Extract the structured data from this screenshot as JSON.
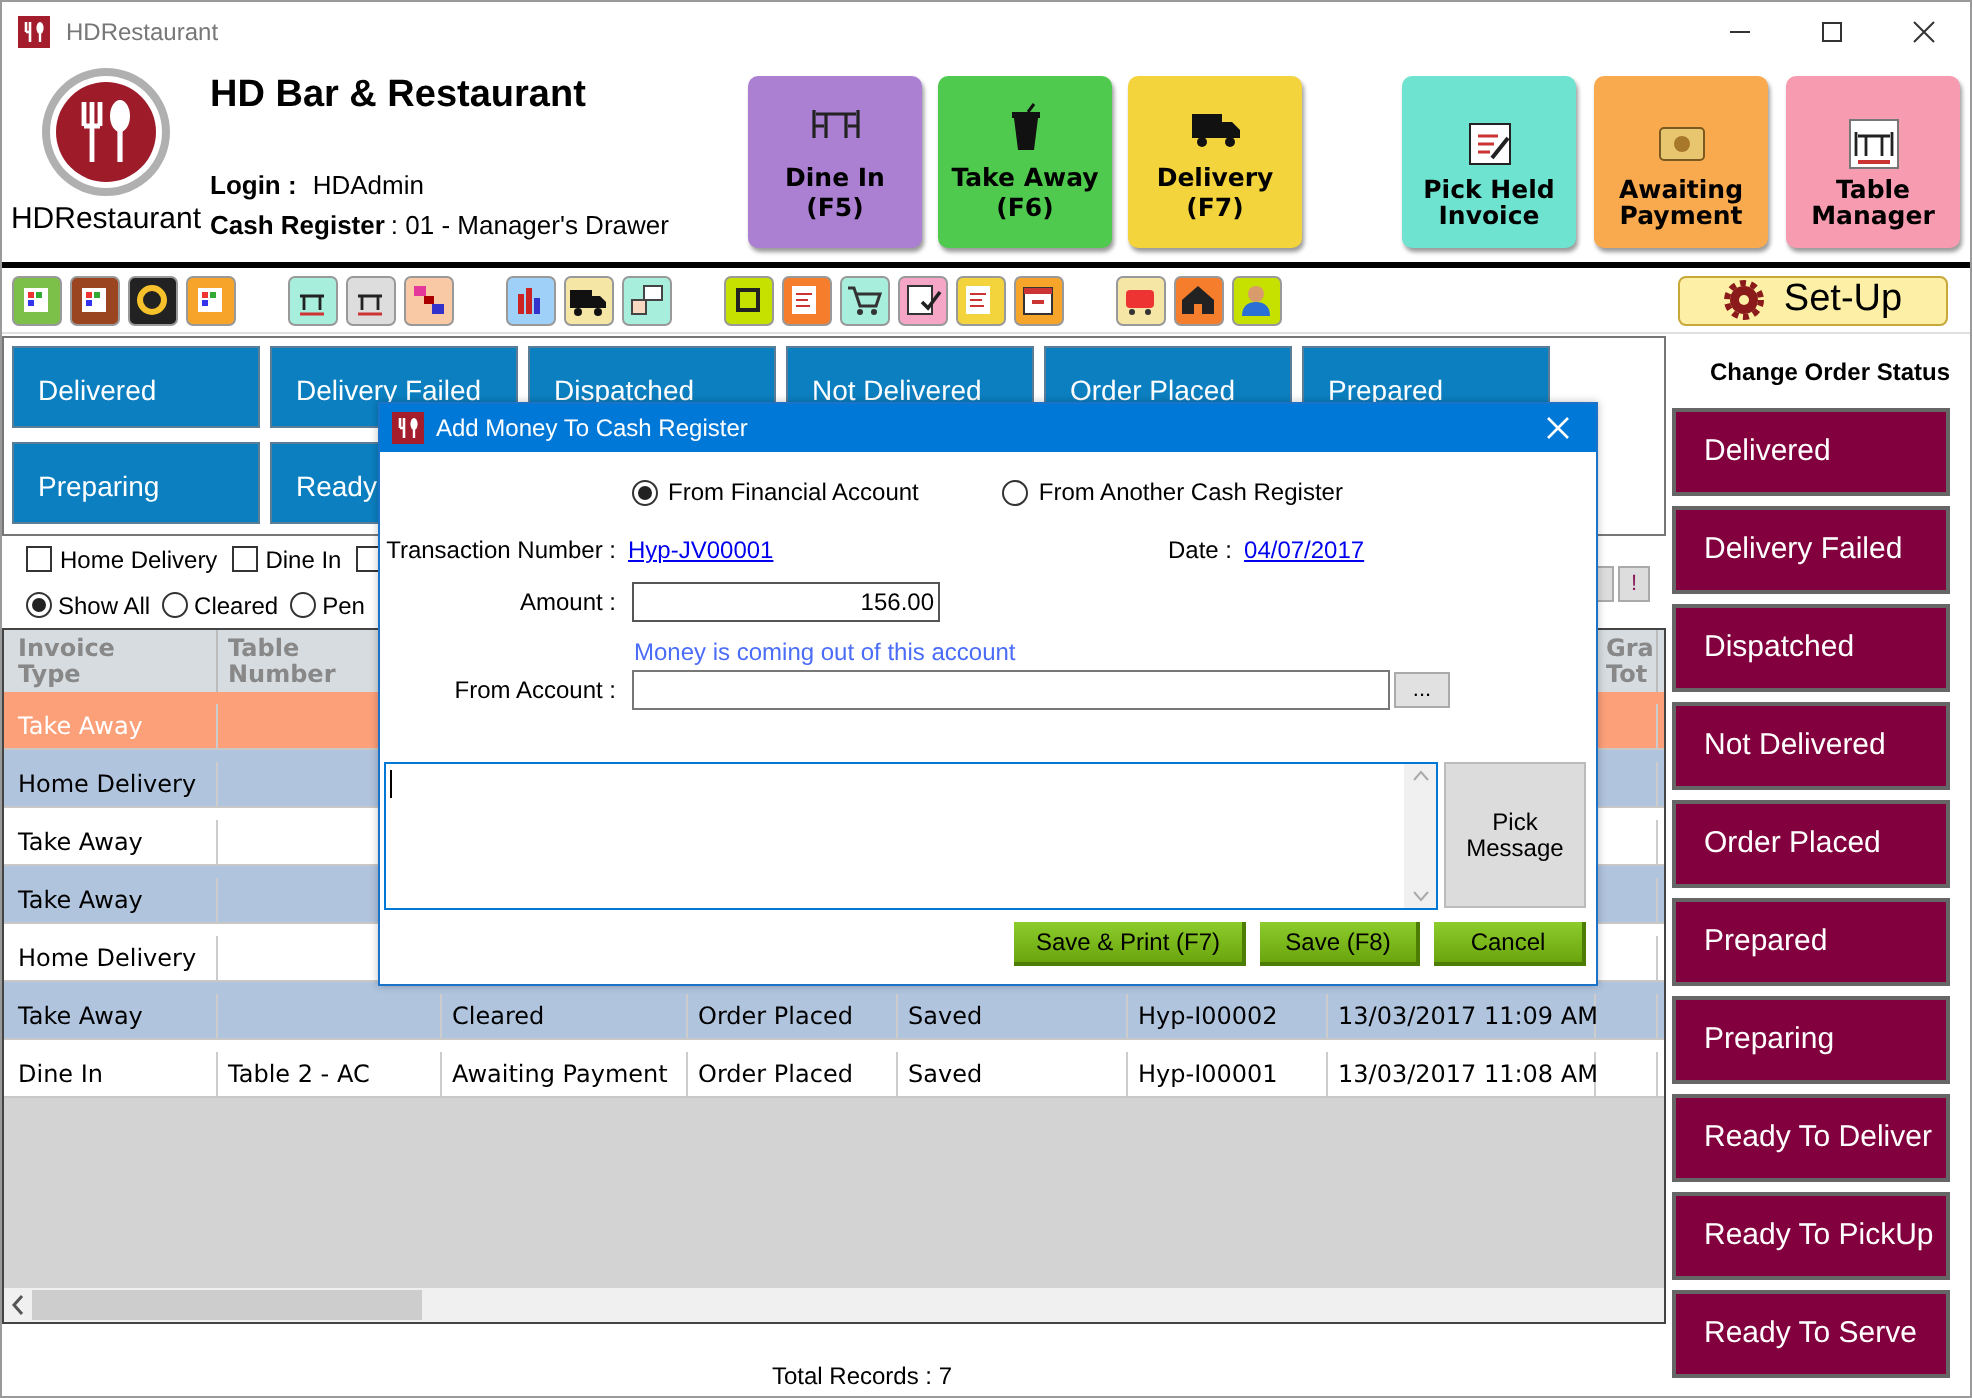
{
  "window": {
    "title": "HDRestaurant"
  },
  "header": {
    "logo_text": "HDRestaurant",
    "business_name": "HD Bar & Restaurant",
    "login_label": "Login :",
    "login_value": "HDAdmin",
    "register_label": "Cash Register",
    "register_value": ": 01 - Manager's Drawer"
  },
  "order_buttons": [
    {
      "label": "Dine In",
      "shortcut": "(F5)",
      "color": "#ab7fd1"
    },
    {
      "label": "Take Away",
      "shortcut": "(F6)",
      "color": "#4fca4f"
    },
    {
      "label": "Delivery",
      "shortcut": "(F7)",
      "color": "#f4d43c"
    }
  ],
  "quick_buttons": [
    {
      "label": "Pick Held Invoice",
      "color": "#6ee3d0"
    },
    {
      "label": "Awaiting Payment",
      "color": "#f9aa4f"
    },
    {
      "label": "Table Manager",
      "color": "#f79bb0"
    }
  ],
  "setup_button": {
    "label": "Set-Up"
  },
  "status_tiles": [
    [
      {
        "label": "Delivered"
      },
      {
        "label": "Delivery Failed"
      },
      {
        "label": "Dispatched"
      },
      {
        "label": "Not Delivered"
      },
      {
        "label": "Order Placed"
      },
      {
        "label": "Prepared"
      }
    ],
    [
      {
        "label": "Preparing"
      },
      {
        "label": "Ready"
      }
    ]
  ],
  "filters": {
    "checkboxes": [
      {
        "label": "Home Delivery",
        "checked": false
      },
      {
        "label": "Dine In",
        "checked": false
      },
      {
        "checked": false
      }
    ],
    "radios": [
      {
        "label": "Show All",
        "selected": true
      },
      {
        "label": "Cleared",
        "selected": false
      },
      {
        "label": "Pen",
        "selected": false
      }
    ],
    "alert_button": "!"
  },
  "table": {
    "columns": [
      "Invoice Type",
      "Table Number",
      null,
      null,
      null,
      null,
      null,
      "Gra Tot"
    ],
    "rows": [
      {
        "selected": true,
        "cells": [
          "Take Away",
          null,
          null,
          null,
          null,
          null,
          null,
          null
        ]
      },
      {
        "selected": false,
        "cells": [
          "Home Delivery",
          null,
          null,
          null,
          null,
          null,
          null,
          null
        ]
      },
      {
        "selected": false,
        "cells": [
          "Take Away",
          null,
          null,
          null,
          null,
          null,
          null,
          null
        ]
      },
      {
        "selected": false,
        "cells": [
          "Take Away",
          null,
          null,
          null,
          null,
          null,
          null,
          null
        ]
      },
      {
        "selected": false,
        "cells": [
          "Home Delivery",
          null,
          null,
          null,
          null,
          null,
          null,
          null
        ]
      },
      {
        "selected": false,
        "cells": [
          "Take Away",
          null,
          "Cleared",
          "Order Placed",
          "Saved",
          "Hyp-I00002",
          "13/03/2017 11:09 AM",
          null
        ]
      },
      {
        "selected": false,
        "cells": [
          "Dine In",
          "Table 2 - AC",
          "Awaiting Payment",
          "Order Placed",
          "Saved",
          "Hyp-I00001",
          "13/03/2017 11:08 AM",
          null
        ]
      }
    ]
  },
  "total_records": "Total Records : 7",
  "sidebar": {
    "title": "Change Order Status",
    "buttons": [
      "Delivered",
      "Delivery Failed",
      "Dispatched",
      "Not Delivered",
      "Order Placed",
      "Prepared",
      "Preparing",
      "Ready To Deliver",
      "Ready To PickUp",
      "Ready To Serve"
    ]
  },
  "dialog": {
    "title": "Add Money To Cash Register",
    "sources": [
      {
        "label": "From Financial Account",
        "selected": true
      },
      {
        "label": "From Another Cash Register",
        "selected": false
      }
    ],
    "transaction_label": "Transaction Number :",
    "transaction_value": "Hyp-JV00001",
    "date_label": "Date :",
    "date_value": "04/07/2017",
    "amount_label": "Amount :",
    "amount_value": "156.00",
    "account_hint": "Money is coming out of this account",
    "account_label": "From Account :",
    "browse_button": "...",
    "pick_message_button": "Pick Message",
    "buttons": [
      "Save & Print (F7)",
      "Save (F8)",
      "Cancel"
    ]
  }
}
